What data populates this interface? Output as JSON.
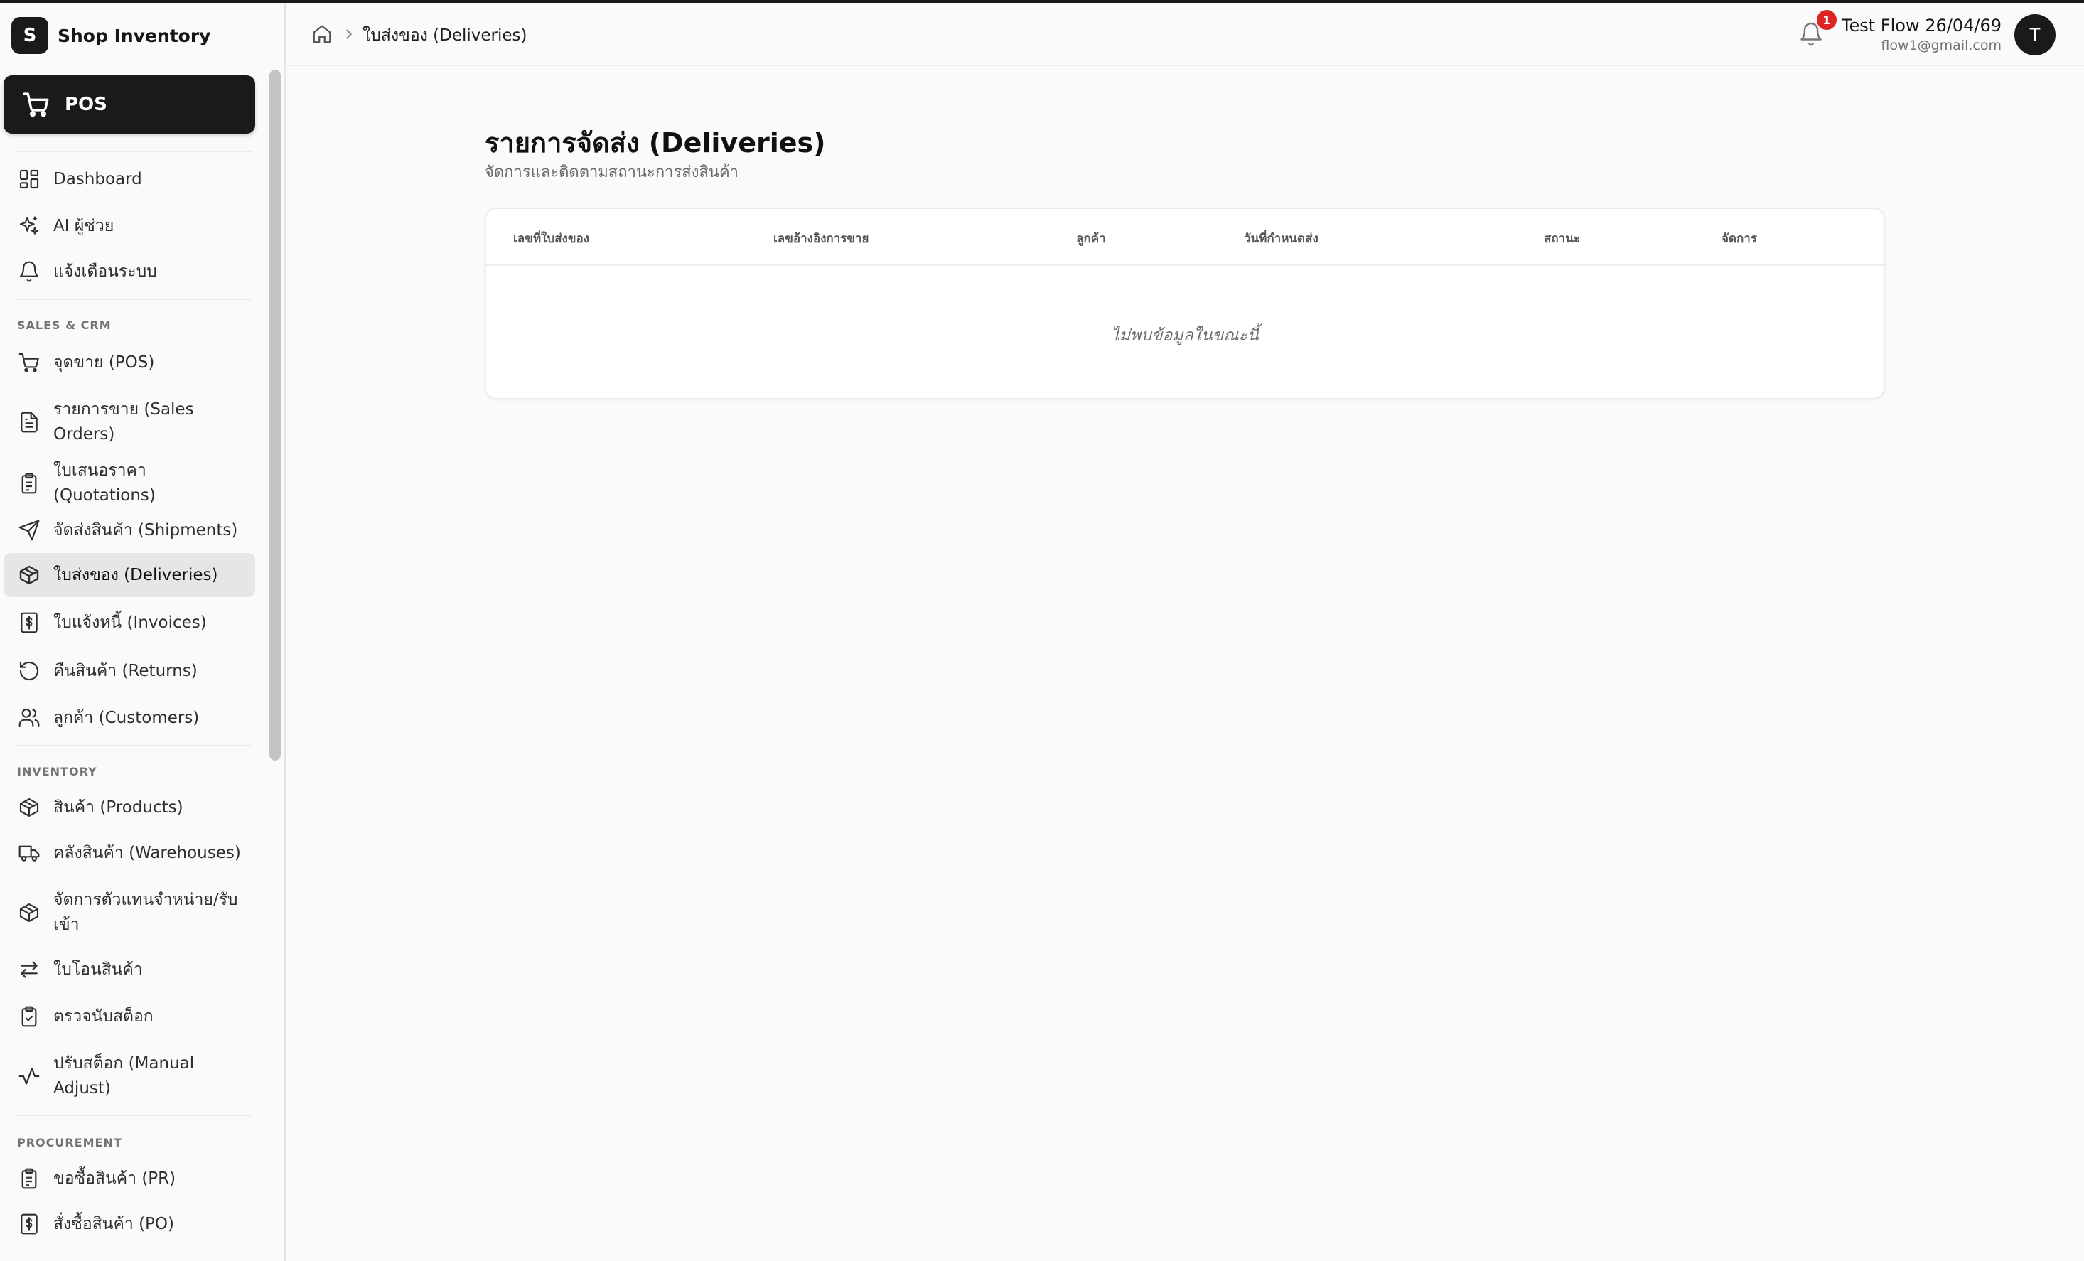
{
  "app": {
    "logo_letter": "S",
    "name": "Shop Inventory"
  },
  "pos_button": {
    "label": "POS"
  },
  "nav": {
    "main": [
      {
        "label": "Dashboard",
        "icon": "dashboard-icon"
      },
      {
        "label": "AI ผู้ช่วย",
        "icon": "sparkles-icon"
      },
      {
        "label": "แจ้งเตือนระบบ",
        "icon": "bell-icon"
      }
    ],
    "sales_section": "SALES & CRM",
    "sales": [
      {
        "label": "จุดขาย (POS)",
        "icon": "cart-icon"
      },
      {
        "label": "รายการขาย (Sales Orders)",
        "icon": "document-icon"
      },
      {
        "label": "ใบเสนอราคา (Quotations)",
        "icon": "clipboard-icon"
      },
      {
        "label": "จัดส่งสินค้า (Shipments)",
        "icon": "send-icon"
      },
      {
        "label": "ใบส่งของ (Deliveries)",
        "icon": "package-icon"
      },
      {
        "label": "ใบแจ้งหนี้ (Invoices)",
        "icon": "invoice-icon"
      },
      {
        "label": "คืนสินค้า (Returns)",
        "icon": "undo-icon"
      },
      {
        "label": "ลูกค้า (Customers)",
        "icon": "users-icon"
      }
    ],
    "inventory_section": "INVENTORY",
    "inventory": [
      {
        "label": "สินค้า (Products)",
        "icon": "box-icon"
      },
      {
        "label": "คลังสินค้า (Warehouses)",
        "icon": "truck-icon"
      },
      {
        "label": "จัดการตัวแทนจำหน่าย/รับเข้า",
        "icon": "box-icon"
      },
      {
        "label": "ใบโอนสินค้า",
        "icon": "transfer-icon"
      },
      {
        "label": "ตรวจนับสต็อก",
        "icon": "clipboard-check-icon"
      },
      {
        "label": "ปรับสต็อก (Manual Adjust)",
        "icon": "activity-icon"
      }
    ],
    "procurement_section": "PROCUREMENT",
    "procurement": [
      {
        "label": "ขอซื้อสินค้า (PR)",
        "icon": "clipboard-list-icon"
      },
      {
        "label": "สั่งซื้อสินค้า (PO)",
        "icon": "dollar-doc-icon"
      }
    ]
  },
  "header": {
    "breadcrumb_current": "ใบส่งของ (Deliveries)",
    "notification_count": "1",
    "user_name": "Test Flow 26/04/69",
    "user_email": "flow1@gmail.com",
    "avatar_letter": "T"
  },
  "main": {
    "title": "รายการจัดส่ง (Deliveries)",
    "subtitle": "จัดการและติดตามสถานะการส่งสินค้า",
    "table": {
      "columns": [
        "เลขที่ใบส่งของ",
        "เลขอ้างอิงการขาย",
        "ลูกค้า",
        "วันที่กำหนดส่ง",
        "สถานะ",
        "จัดการ"
      ],
      "empty_message": "ไม่พบข้อมูลในขณะนี้"
    }
  },
  "colors": {
    "brand": "#1a1a1a",
    "badge": "#dc2626",
    "active_nav": "#e6e6e6"
  }
}
